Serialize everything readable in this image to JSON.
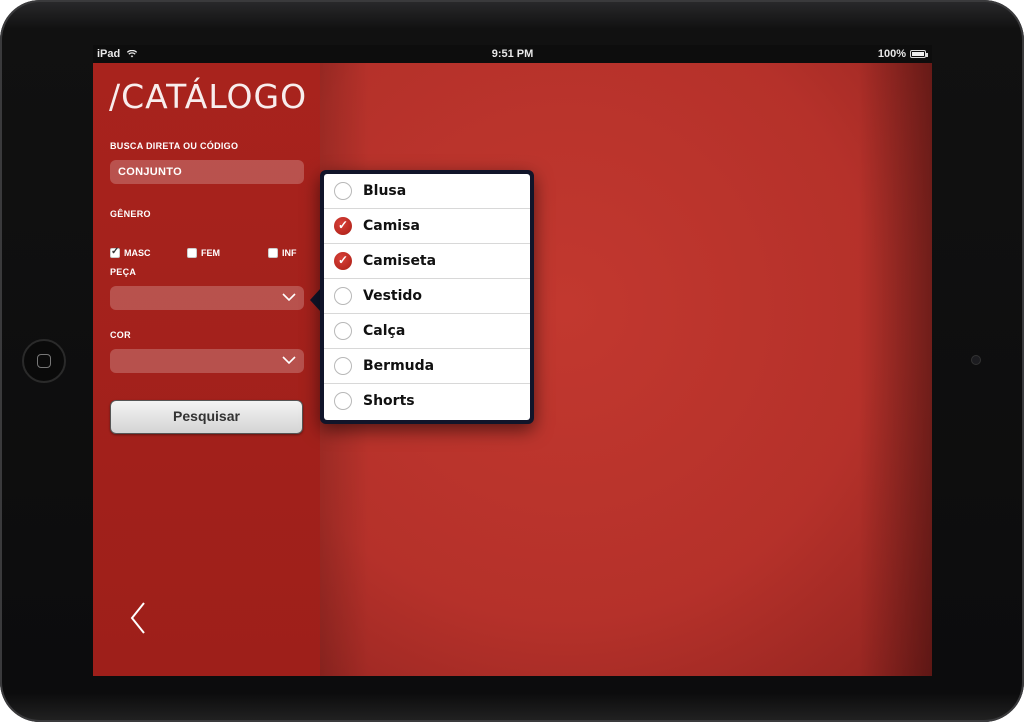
{
  "status_bar": {
    "device": "iPad",
    "time": "9:51 PM",
    "battery": "100%"
  },
  "sidebar": {
    "title": "/CATÁLOGO",
    "search": {
      "label": "BUSCA DIRETA OU CÓDIGO",
      "value": "CONJUNTO"
    },
    "genero": {
      "label": "GÊNERO",
      "options": [
        {
          "label": "MASC",
          "checked": true
        },
        {
          "label": "FEM",
          "checked": false
        },
        {
          "label": "INF",
          "checked": false
        }
      ]
    },
    "peca": {
      "label": "PEÇA",
      "value": ""
    },
    "cor": {
      "label": "COR",
      "value": ""
    },
    "search_button": "Pesquisar"
  },
  "popover": {
    "items": [
      {
        "label": "Blusa",
        "checked": false
      },
      {
        "label": "Camisa",
        "checked": true
      },
      {
        "label": "Camiseta",
        "checked": true
      },
      {
        "label": "Vestido",
        "checked": false
      },
      {
        "label": "Calça",
        "checked": false
      },
      {
        "label": "Bermuda",
        "checked": false
      },
      {
        "label": "Shorts",
        "checked": false
      }
    ]
  },
  "icons": {
    "wifi": "wifi-icon",
    "battery": "battery-icon",
    "chevron": "chevron-down-icon",
    "back": "back-arrow-icon",
    "home": "home-button-icon"
  },
  "colors": {
    "brand_red": "#b9322b",
    "sidebar_red": "#a8231d",
    "check_red": "#c0302a"
  }
}
